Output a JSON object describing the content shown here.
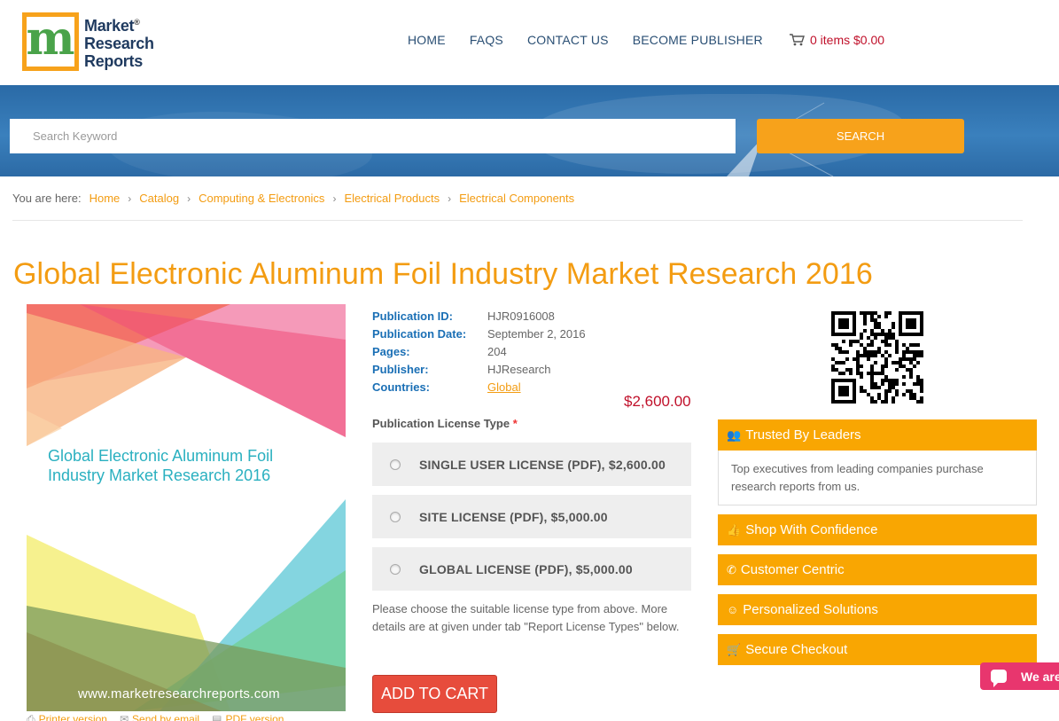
{
  "header": {
    "logo": {
      "line1": "Market",
      "line2": "Research",
      "line3": "Reports",
      "mark": "m",
      "reg": "®"
    },
    "nav": [
      "HOME",
      "FAQS",
      "CONTACT US",
      "BECOME PUBLISHER"
    ],
    "cart": {
      "icon": "cart-icon",
      "text": "0 items $0.00"
    }
  },
  "search": {
    "placeholder": "Search Keyword",
    "button": "SEARCH"
  },
  "breadcrumb": {
    "lead": "You are here:",
    "items": [
      "Home",
      "Catalog",
      "Computing & Electronics",
      "Electrical Products",
      "Electrical Components"
    ]
  },
  "page": {
    "title": "Global Electronic Aluminum Foil Industry Market Research 2016"
  },
  "cover": {
    "title": "Global Electronic Aluminum Foil Industry Market Research 2016",
    "url": "www.marketresearchreports.com"
  },
  "publication": {
    "rows": [
      {
        "label": "Publication ID:",
        "value": "HJR0916008"
      },
      {
        "label": "Publication Date:",
        "value": "September 2, 2016"
      },
      {
        "label": "Pages:",
        "value": "204"
      },
      {
        "label": "Publisher:",
        "value": "HJResearch"
      },
      {
        "label": "Countries:",
        "value": "Global"
      }
    ],
    "price": "$2,600.00"
  },
  "license": {
    "label": "Publication License Type",
    "required_mark": "*",
    "options": [
      "SINGLE USER LICENSE (PDF), $2,600.00",
      "SITE LICENSE (PDF), $5,000.00",
      "GLOBAL LICENSE (PDF), $5,000.00"
    ],
    "note": "Please choose the suitable license type from above. More details are at given under tab \"Report License Types\" below.",
    "add_to_cart": "ADD TO CART"
  },
  "tools": [
    "Printer version",
    "Send by email",
    "PDF version"
  ],
  "trust": {
    "items": [
      {
        "icon": "users-icon",
        "label": "Trusted By Leaders"
      },
      {
        "icon": "thumbs-up-icon",
        "label": "Shop With Confidence"
      },
      {
        "icon": "phone-icon",
        "label": "Customer Centric"
      },
      {
        "icon": "smile-icon",
        "label": "Personalized Solutions"
      },
      {
        "icon": "cart-icon",
        "label": "Secure Checkout"
      }
    ],
    "first_body": "Top executives from leading companies purchase research reports from us."
  },
  "chat": {
    "label": "We are"
  },
  "colors": {
    "accent": "#f39c12",
    "panel": "#f9a602",
    "link_blue": "#1a6fb5",
    "price": "#c0102a",
    "cart_button": "#e74c3c",
    "banner": "#3a80bd"
  }
}
